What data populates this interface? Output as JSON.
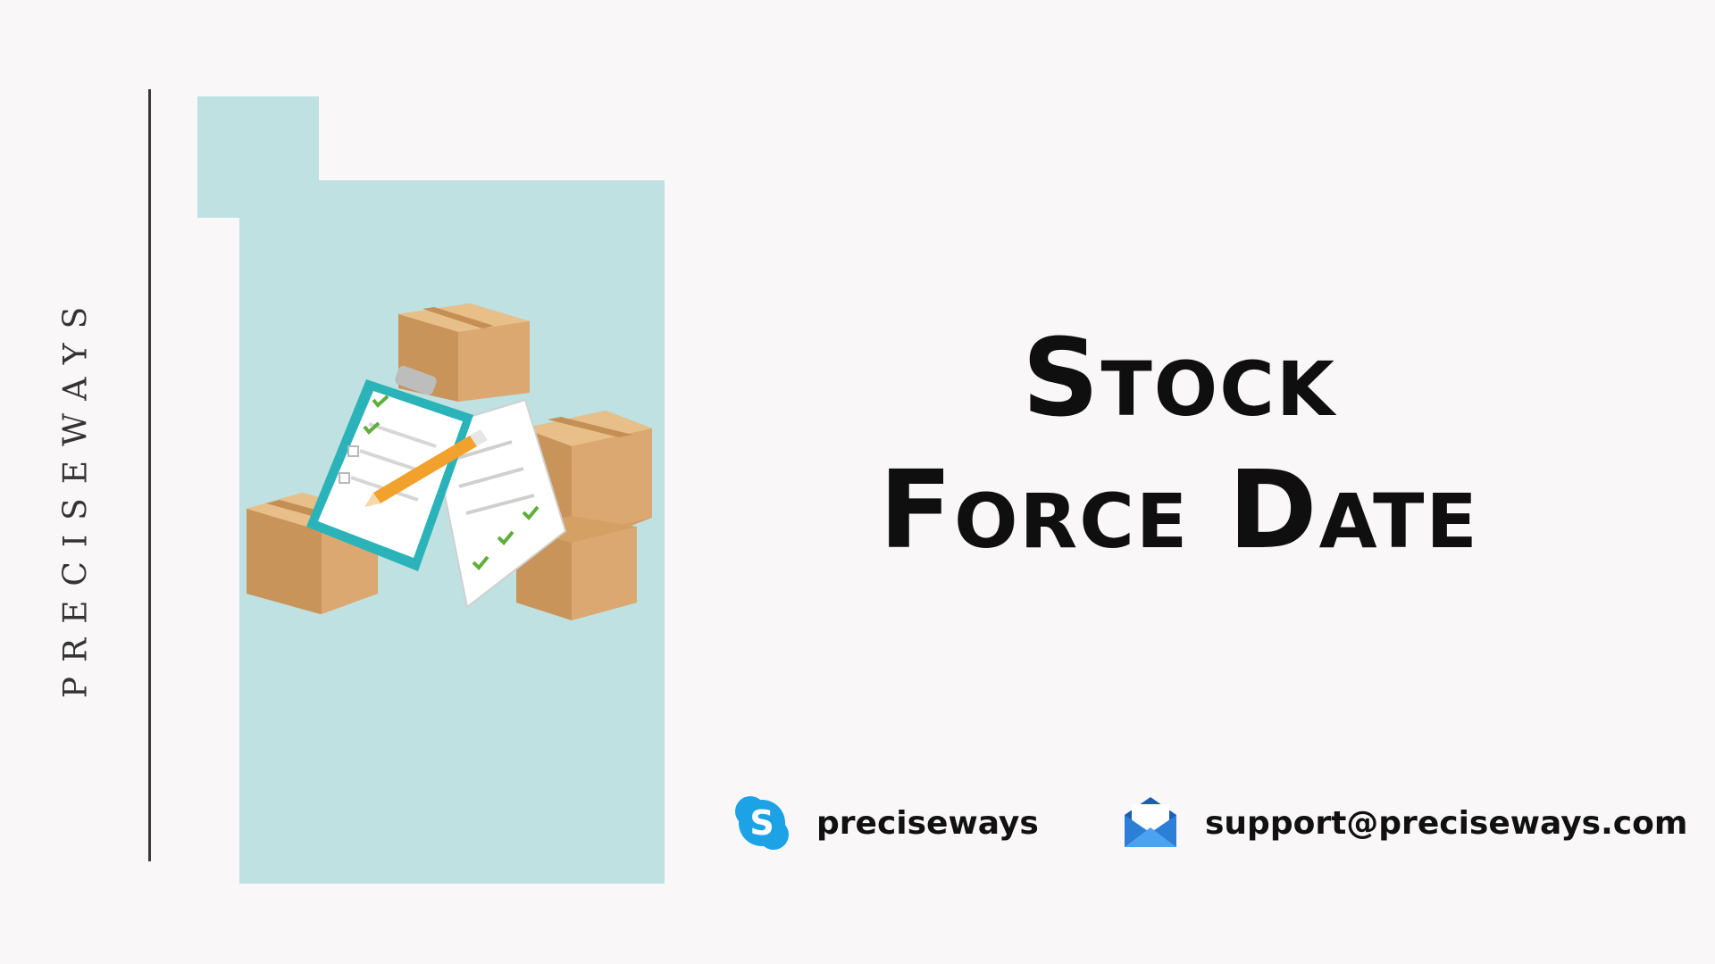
{
  "brand": {
    "vertical_text": "PRECISEWAYS"
  },
  "title": {
    "line1": "Stock",
    "line2": "Force Date"
  },
  "contacts": {
    "skype": {
      "icon": "skype-icon",
      "label": "preciseways"
    },
    "email": {
      "icon": "mail-icon",
      "label": "support@preciseways.com"
    }
  },
  "colors": {
    "background": "#f9f7f8",
    "panel": "#bfe1e1",
    "box": "#d8a66a",
    "clipboard": "#2ab3b8",
    "pencil": "#f2a12c",
    "skype_blue": "#1ea2e6",
    "mail_blue": "#2b7fd6"
  },
  "illustration": {
    "icon": "inventory-boxes-clipboard-icon"
  }
}
